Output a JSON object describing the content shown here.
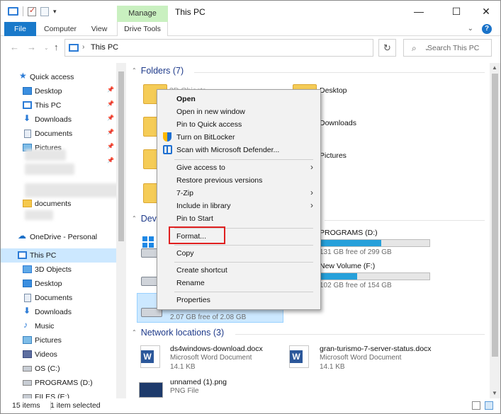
{
  "window": {
    "title": "This PC",
    "manage_label": "Manage",
    "controls": {
      "minimize": "—",
      "maximize": "☐",
      "close": "✕"
    }
  },
  "ribbon": {
    "tabs": [
      "File",
      "Computer",
      "View",
      "Drive Tools"
    ],
    "help": "?"
  },
  "address": {
    "path": "This PC",
    "search_placeholder": "Search This PC"
  },
  "sidebar": {
    "quick_access": "Quick access",
    "items": [
      "Desktop",
      "This PC",
      "Downloads",
      "Documents",
      "Pictures",
      "documents"
    ],
    "onedrive": "OneDrive - Personal",
    "this_pc": "This PC",
    "pc_items": [
      "3D Objects",
      "Desktop",
      "Documents",
      "Downloads",
      "Music",
      "Pictures",
      "Videos",
      "OS (C:)",
      "PROGRAMS (D:)",
      "FILES (E:)"
    ]
  },
  "main": {
    "folders_header": "Folders (7)",
    "folders": [
      "3D Objects",
      "Desktop",
      "Downloads",
      "Pictures"
    ],
    "devices_header": "Dev",
    "drives": [
      {
        "name": "PROGRAMS (D:)",
        "free": "131 GB free of 299 GB",
        "fill": 0.56
      },
      {
        "name": "New Volume (F:)",
        "free": "102 GB free of 154 GB",
        "fill": 0.34
      }
    ],
    "selected_drive_free": "2.07 GB free of 2.08 GB",
    "network_header": "Network locations (3)",
    "network": [
      {
        "name": "ds4windows-download.docx",
        "type": "Microsoft Word Document",
        "size": "14.1 KB"
      },
      {
        "name": "gran-turismo-7-server-status.docx",
        "type": "Microsoft Word Document",
        "size": "14.1 KB"
      },
      {
        "name": "unnamed (1).png",
        "type": "PNG File"
      }
    ]
  },
  "context_menu": {
    "items": [
      "Open",
      "Open in new window",
      "Pin to Quick access",
      "Turn on BitLocker",
      "Scan with Microsoft Defender...",
      "Give access to",
      "Restore previous versions",
      "7-Zip",
      "Include in library",
      "Pin to Start",
      "Format...",
      "Copy",
      "Create shortcut",
      "Rename",
      "Properties"
    ]
  },
  "status": {
    "count": "15 items",
    "selected": "1 item selected"
  },
  "colors": {
    "accent": "#1979ca",
    "manage": "#c9f0c0",
    "highlight": "#e02020",
    "selection": "#cce8ff"
  }
}
